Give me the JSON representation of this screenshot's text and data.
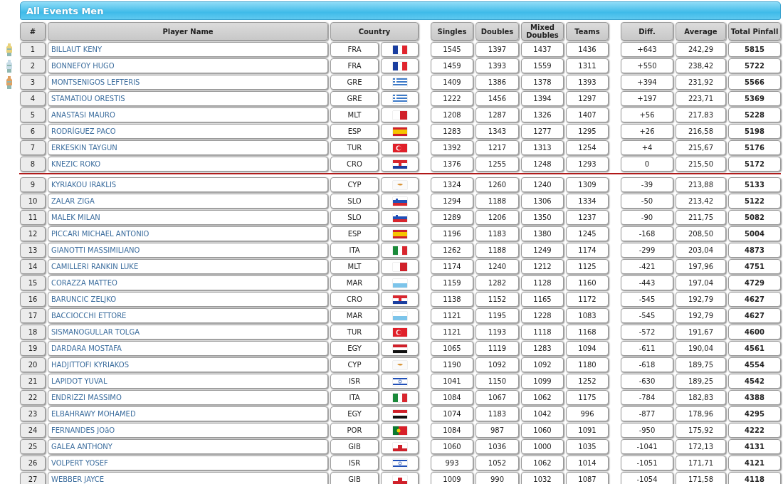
{
  "title": "All Events Men",
  "columns": [
    "#",
    "Player Name",
    "Country",
    "Singles",
    "Doubles",
    "Mixed Doubles",
    "Teams",
    "Diff.",
    "Average",
    "Total Pinfall"
  ],
  "groups": [
    {
      "rows": [
        {
          "rank": "1",
          "medal": {
            "color": "#e8d27a"
          },
          "name": "BILLAUT KENY",
          "country": "FRA",
          "flag": {
            "kind": "fr"
          },
          "singles": "1545",
          "doubles": "1397",
          "mixed": "1437",
          "teams": "1436",
          "diff": "+643",
          "average": "242,29",
          "total": "5815"
        },
        {
          "rank": "2",
          "medal": {
            "color": "#c8dde8"
          },
          "name": "BONNEFOY HUGO",
          "country": "FRA",
          "flag": {
            "kind": "fr"
          },
          "singles": "1459",
          "doubles": "1393",
          "mixed": "1559",
          "teams": "1311",
          "diff": "+550",
          "average": "238,42",
          "total": "5722"
        },
        {
          "rank": "3",
          "medal": {
            "color": "#e0a060"
          },
          "name": "MONTSENIGOS LEFTERIS",
          "country": "GRE",
          "flag": {
            "kind": "gr"
          },
          "singles": "1409",
          "doubles": "1386",
          "mixed": "1378",
          "teams": "1393",
          "diff": "+394",
          "average": "231,92",
          "total": "5566"
        },
        {
          "rank": "4",
          "name": "STAMATIOU ORESTIS",
          "country": "GRE",
          "flag": {
            "kind": "gr"
          },
          "singles": "1222",
          "doubles": "1456",
          "mixed": "1394",
          "teams": "1297",
          "diff": "+197",
          "average": "223,71",
          "total": "5369"
        },
        {
          "rank": "5",
          "name": "ANASTASI MAURO",
          "country": "MLT",
          "flag": {
            "kind": "mt"
          },
          "singles": "1208",
          "doubles": "1287",
          "mixed": "1326",
          "teams": "1407",
          "diff": "+56",
          "average": "217,83",
          "total": "5228"
        },
        {
          "rank": "6",
          "name": "RODRÍGUEZ PACO",
          "country": "ESP",
          "flag": {
            "kind": "es"
          },
          "singles": "1283",
          "doubles": "1343",
          "mixed": "1277",
          "teams": "1295",
          "diff": "+26",
          "average": "216,58",
          "total": "5198"
        },
        {
          "rank": "7",
          "name": "ERKESKIN TAYGUN",
          "country": "TUR",
          "flag": {
            "kind": "tr"
          },
          "singles": "1392",
          "doubles": "1217",
          "mixed": "1313",
          "teams": "1254",
          "diff": "+4",
          "average": "215,67",
          "total": "5176"
        },
        {
          "rank": "8",
          "name": "KNEZIC ROKO",
          "country": "CRO",
          "flag": {
            "kind": "hr"
          },
          "singles": "1376",
          "doubles": "1255",
          "mixed": "1248",
          "teams": "1293",
          "diff": "0",
          "average": "215,50",
          "total": "5172"
        }
      ]
    },
    {
      "rows": [
        {
          "rank": "9",
          "name": "KYRIAKOU IRAKLIS",
          "country": "CYP",
          "flag": {
            "kind": "cy"
          },
          "singles": "1324",
          "doubles": "1260",
          "mixed": "1240",
          "teams": "1309",
          "diff": "-39",
          "average": "213,88",
          "total": "5133"
        },
        {
          "rank": "10",
          "name": "ZALAR ZIGA",
          "country": "SLO",
          "flag": {
            "kind": "si"
          },
          "singles": "1294",
          "doubles": "1188",
          "mixed": "1306",
          "teams": "1334",
          "diff": "-50",
          "average": "213,42",
          "total": "5122"
        },
        {
          "rank": "11",
          "name": "MALEK MILAN",
          "country": "SLO",
          "flag": {
            "kind": "si"
          },
          "singles": "1289",
          "doubles": "1206",
          "mixed": "1350",
          "teams": "1237",
          "diff": "-90",
          "average": "211,75",
          "total": "5082"
        },
        {
          "rank": "12",
          "name": "PICCARI MICHAEL ANTONIO",
          "country": "ESP",
          "flag": {
            "kind": "es"
          },
          "singles": "1196",
          "doubles": "1183",
          "mixed": "1380",
          "teams": "1245",
          "diff": "-168",
          "average": "208,50",
          "total": "5004"
        },
        {
          "rank": "13",
          "name": "GIANOTTI MASSIMILIANO",
          "country": "ITA",
          "flag": {
            "kind": "it"
          },
          "singles": "1262",
          "doubles": "1188",
          "mixed": "1249",
          "teams": "1174",
          "diff": "-299",
          "average": "203,04",
          "total": "4873"
        },
        {
          "rank": "14",
          "name": "CAMILLERI RANKIN LUKE",
          "country": "MLT",
          "flag": {
            "kind": "mt"
          },
          "singles": "1174",
          "doubles": "1240",
          "mixed": "1212",
          "teams": "1125",
          "diff": "-421",
          "average": "197,96",
          "total": "4751"
        },
        {
          "rank": "15",
          "name": "CORAZZA MATTEO",
          "country": "MAR",
          "flag": {
            "kind": "sm"
          },
          "singles": "1159",
          "doubles": "1282",
          "mixed": "1128",
          "teams": "1160",
          "diff": "-443",
          "average": "197,04",
          "total": "4729"
        },
        {
          "rank": "16",
          "name": "BARUNCIC ZELJKO",
          "country": "CRO",
          "flag": {
            "kind": "hr"
          },
          "singles": "1138",
          "doubles": "1152",
          "mixed": "1165",
          "teams": "1172",
          "diff": "-545",
          "average": "192,79",
          "total": "4627"
        },
        {
          "rank": "17",
          "name": "BACCIOCCHI ETTORE",
          "country": "MAR",
          "flag": {
            "kind": "sm"
          },
          "singles": "1121",
          "doubles": "1195",
          "mixed": "1228",
          "teams": "1083",
          "diff": "-545",
          "average": "192,79",
          "total": "4627"
        },
        {
          "rank": "18",
          "name": "SISMANOGULLAR TOLGA",
          "country": "TUR",
          "flag": {
            "kind": "tr"
          },
          "singles": "1121",
          "doubles": "1193",
          "mixed": "1118",
          "teams": "1168",
          "diff": "-572",
          "average": "191,67",
          "total": "4600"
        },
        {
          "rank": "19",
          "name": "DARDARA MOSTAFA",
          "country": "EGY",
          "flag": {
            "kind": "eg"
          },
          "singles": "1065",
          "doubles": "1119",
          "mixed": "1283",
          "teams": "1094",
          "diff": "-611",
          "average": "190,04",
          "total": "4561"
        },
        {
          "rank": "20",
          "name": "HADJITTOFI KYRIAKOS",
          "country": "CYP",
          "flag": {
            "kind": "cy"
          },
          "singles": "1190",
          "doubles": "1092",
          "mixed": "1092",
          "teams": "1180",
          "diff": "-618",
          "average": "189,75",
          "total": "4554"
        },
        {
          "rank": "21",
          "name": "LAPIDOT YUVAL",
          "country": "ISR",
          "flag": {
            "kind": "il"
          },
          "singles": "1041",
          "doubles": "1150",
          "mixed": "1099",
          "teams": "1252",
          "diff": "-630",
          "average": "189,25",
          "total": "4542"
        },
        {
          "rank": "22",
          "name": "ENDRIZZI MASSIMO",
          "country": "ITA",
          "flag": {
            "kind": "it"
          },
          "singles": "1084",
          "doubles": "1067",
          "mixed": "1062",
          "teams": "1175",
          "diff": "-784",
          "average": "182,83",
          "total": "4388"
        },
        {
          "rank": "23",
          "name": "ELBAHRAWY MOHAMED",
          "country": "EGY",
          "flag": {
            "kind": "eg"
          },
          "singles": "1074",
          "doubles": "1183",
          "mixed": "1042",
          "teams": "996",
          "diff": "-877",
          "average": "178,96",
          "total": "4295"
        },
        {
          "rank": "24",
          "name": "FERNANDES JOãO",
          "country": "POR",
          "flag": {
            "kind": "pt"
          },
          "singles": "1084",
          "doubles": "987",
          "mixed": "1060",
          "teams": "1091",
          "diff": "-950",
          "average": "175,92",
          "total": "4222"
        },
        {
          "rank": "25",
          "name": "GALEA ANTHONY",
          "country": "GIB",
          "flag": {
            "kind": "gi"
          },
          "singles": "1060",
          "doubles": "1036",
          "mixed": "1000",
          "teams": "1035",
          "diff": "-1041",
          "average": "172,13",
          "total": "4131"
        },
        {
          "rank": "26",
          "name": "VOLPERT YOSEF",
          "country": "ISR",
          "flag": {
            "kind": "il"
          },
          "singles": "993",
          "doubles": "1052",
          "mixed": "1062",
          "teams": "1014",
          "diff": "-1051",
          "average": "171,71",
          "total": "4121"
        },
        {
          "rank": "27",
          "name": "WEBBER JAYCE",
          "country": "GIB",
          "flag": {
            "kind": "gi"
          },
          "singles": "1009",
          "doubles": "990",
          "mixed": "1032",
          "teams": "1087",
          "diff": "-1054",
          "average": "171,58",
          "total": "4118"
        }
      ]
    }
  ]
}
